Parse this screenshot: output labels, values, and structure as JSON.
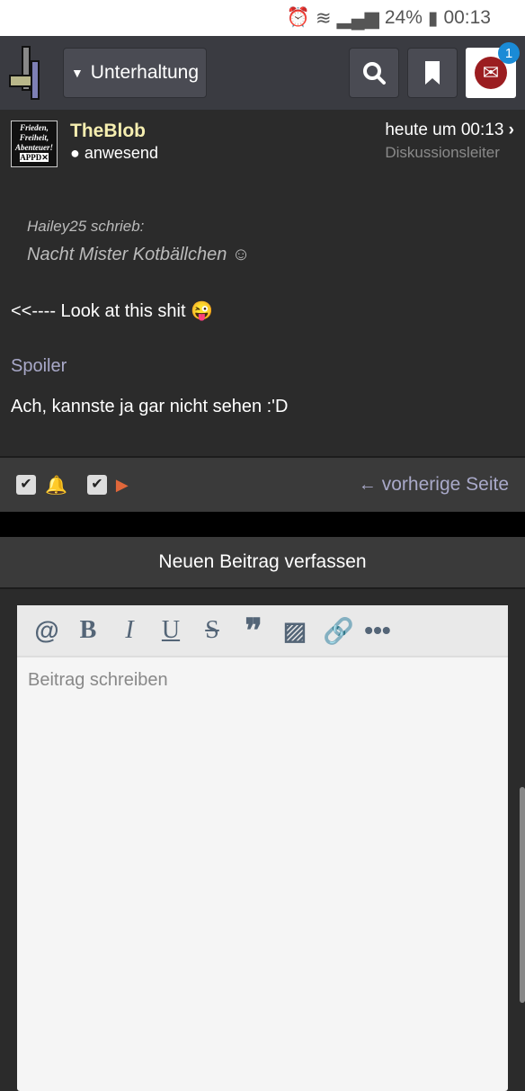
{
  "status_bar": {
    "battery": "24%",
    "time": "00:13"
  },
  "header": {
    "forum_label": "Unterhaltung",
    "notification_count": "1"
  },
  "post": {
    "author": "TheBlob",
    "author_avatar_text": "Frieden, Freiheit, Abenteuer! APPD",
    "status": "anwesend",
    "time": "heute um 00:13",
    "role": "Diskussionsleiter",
    "quote_author": "Hailey25 schrieb:",
    "quote_text": "Nacht Mister Kotbällchen",
    "body1": "<<---- Look at this shit",
    "spoiler": "Spoiler",
    "body2": "Ach, kannste ja gar nicht sehen :'D"
  },
  "actions": {
    "prev_page": "vorherige Seite"
  },
  "new_post": {
    "title": "Neuen Beitrag verfassen",
    "placeholder": "Beitrag schreiben"
  },
  "colors": {
    "accent": "#a9a9c9",
    "username": "#f5eeb0",
    "badge": "#1a8bd6"
  }
}
